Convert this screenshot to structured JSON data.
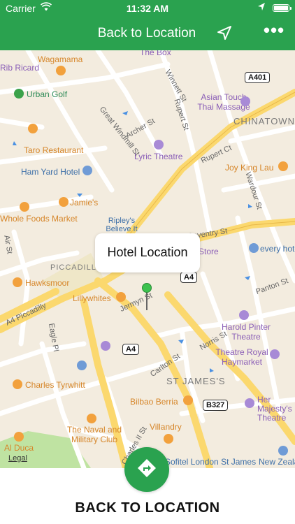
{
  "status_bar": {
    "carrier": "Carrier",
    "time": "11:32 AM"
  },
  "nav_bar": {
    "title": "Back to Location",
    "navigation_icon": "location-arrow-icon",
    "more_icon": "more-dots-icon",
    "background_color": "#2aa24f"
  },
  "map": {
    "callout": "Hotel Location",
    "legal": "Legal",
    "areas": [
      "CHINATOWN",
      "PICCADILLY CIRCUS",
      "ST JAMES'S"
    ],
    "road_shields": [
      "A401",
      "A4",
      "A4",
      "B327"
    ],
    "streets": [
      "Great Windmill St",
      "Archer St",
      "Winnett St",
      "Rupert St",
      "Rupert Ct",
      "Wardour St",
      "Coventry St",
      "Jermyn St",
      "A4 Piccadilly",
      "Eagle Pl",
      "Norris St",
      "Carlton St",
      "Charles II St",
      "Panton St",
      "Air St"
    ],
    "places": [
      {
        "name": "Wagamama",
        "color": "orange"
      },
      {
        "name": "Urban Golf",
        "color": "green"
      },
      {
        "name": "Asian Touch Thai Massage",
        "color": "purple"
      },
      {
        "name": "Taro Restaurant",
        "color": "orange"
      },
      {
        "name": "Lyric Theatre",
        "color": "purple"
      },
      {
        "name": "Ham Yard Hotel",
        "color": "blue"
      },
      {
        "name": "Joy King Lau",
        "color": "orange"
      },
      {
        "name": "Jamie's",
        "color": "orange"
      },
      {
        "name": "Whole Foods Market",
        "color": "orange"
      },
      {
        "name": "Ripley's Believe It Or Not",
        "color": "blue"
      },
      {
        "name": "The Comedy Store",
        "color": "purple"
      },
      {
        "name": "every hotel",
        "color": "blue"
      },
      {
        "name": "Hawksmoor",
        "color": "orange"
      },
      {
        "name": "Lillywhites",
        "color": "orange"
      },
      {
        "name": "Harold Pinter Theatre",
        "color": "purple"
      },
      {
        "name": "Theatre Royal Haymarket",
        "color": "purple"
      },
      {
        "name": "Charles Tyrwhitt",
        "color": "orange"
      },
      {
        "name": "Bilbao Berria",
        "color": "orange"
      },
      {
        "name": "Her Majesty's Theatre",
        "color": "purple"
      },
      {
        "name": "The Naval and Military Club",
        "color": "orange"
      },
      {
        "name": "Villandry",
        "color": "orange"
      },
      {
        "name": "Al Duca",
        "color": "orange"
      },
      {
        "name": "Sofitel London St James",
        "color": "blue"
      },
      {
        "name": "New Zealand High Commission",
        "color": "blue"
      },
      {
        "name": "Rib Ricard",
        "color": "purple"
      },
      {
        "name": "The Box",
        "color": "purple"
      }
    ]
  },
  "bottom": {
    "fab_icon": "directions-icon",
    "label": "BACK TO LOCATION"
  }
}
